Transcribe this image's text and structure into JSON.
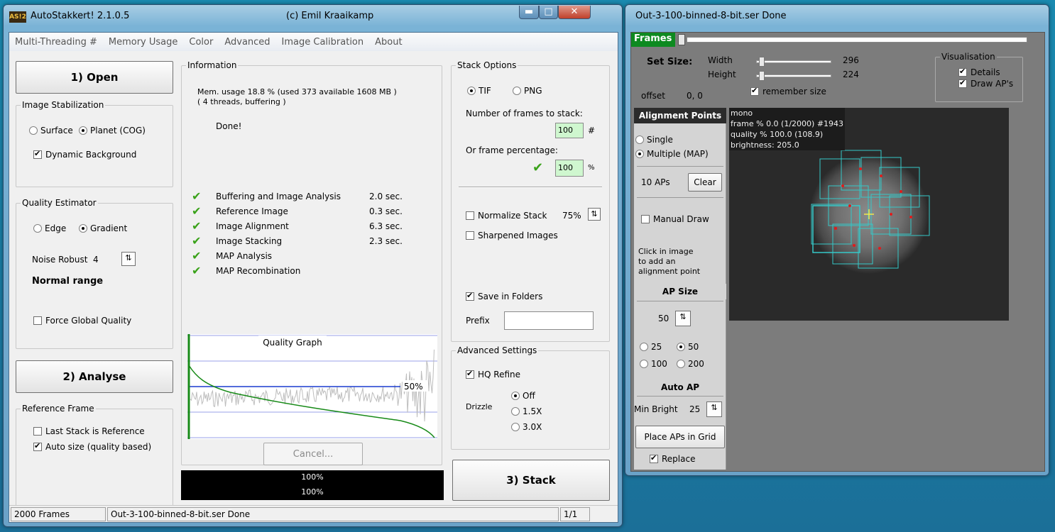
{
  "main": {
    "title": "AutoStakkert! 2.1.0.5",
    "author": "(c) Emil Kraaikamp",
    "app_icon": "AS!2",
    "menu": [
      "Multi-Threading #",
      "Memory Usage",
      "Color",
      "Advanced",
      "Image Calibration",
      "About"
    ],
    "open_btn": "1) Open",
    "stab_group": "Image Stabilization",
    "surface": "Surface",
    "planet": "Planet (COG)",
    "dyn_bg": "Dynamic Background",
    "quality_group": "Quality Estimator",
    "edge": "Edge",
    "gradient": "Gradient",
    "noise_label": "Noise Robust",
    "noise_value": "4",
    "normal_range": "Normal range",
    "force_global": "Force Global Quality",
    "analyse_btn": "2) Analyse",
    "ref_group": "Reference Frame",
    "last_stack": "Last Stack is Reference",
    "auto_size": "Auto size (quality based)",
    "info_group": "Information",
    "mem_usage": "Mem. usage 18.8 %  (used 373 available 1608 MB )",
    "threads": "( 4 threads, buffering )",
    "done": "Done!",
    "steps": [
      {
        "label": "Buffering and Image Analysis",
        "time": "2.0 sec."
      },
      {
        "label": "Reference Image",
        "time": "0.3 sec."
      },
      {
        "label": "Image Alignment",
        "time": "6.3 sec."
      },
      {
        "label": "Image Stacking",
        "time": "2.3 sec."
      },
      {
        "label": "MAP Analysis",
        "time": ""
      },
      {
        "label": "MAP Recombination",
        "time": ""
      }
    ],
    "graph_title": "Quality Graph",
    "graph_pct": "50%",
    "cancel_btn": "Cancel...",
    "progress1": "100%",
    "progress2": "100%",
    "stack_group": "Stack Options",
    "tif": "TIF",
    "png": "PNG",
    "frames_label": "Number of frames to stack:",
    "frames_value": "100",
    "frames_unit": "#",
    "pct_label": "Or frame percentage:",
    "pct_value": "100",
    "pct_unit": "%",
    "normalize": "Normalize Stack",
    "normalize_val": "75%",
    "sharpened": "Sharpened Images",
    "save_folders": "Save in Folders",
    "prefix": "Prefix",
    "adv_group": "Advanced Settings",
    "hq_refine": "HQ Refine",
    "drizzle": "Drizzle",
    "drizzle_off": "Off",
    "drizzle_15": "1.5X",
    "drizzle_30": "3.0X",
    "stack_btn": "3) Stack",
    "status_frames": "2000 Frames",
    "status_file": "Out-3-100-binned-8-bit.ser  Done",
    "status_page": "1/1"
  },
  "viewer": {
    "title": "Out-3-100-binned-8-bit.ser  Done",
    "frames_label": "Frames",
    "set_size": "Set Size:",
    "width_label": "Width",
    "width_value": "296",
    "height_label": "Height",
    "height_value": "224",
    "remember": "remember size",
    "offset_label": "offset",
    "offset_value": "0, 0",
    "vis_group": "Visualisation",
    "details": "Details",
    "draw_aps": "Draw AP's",
    "ap_header": "Alignment Points",
    "single": "Single",
    "multiple": "Multiple (MAP)",
    "ap_count": "10 APs",
    "clear_btn": "Clear",
    "manual_draw": "Manual Draw",
    "help1": "Click in image",
    "help2": "to add an",
    "help3": "alignment point",
    "ap_size": "AP Size",
    "ap_size_val": "50",
    "s25": "25",
    "s50": "50",
    "s100": "100",
    "s200": "200",
    "auto_ap": "Auto AP",
    "min_bright": "Min Bright",
    "min_bright_val": "25",
    "place_btn": "Place APs in Grid",
    "replace": "Replace",
    "ov1": "mono",
    "ov2": "frame % 0.0 (1/2000) #1943",
    "ov3": "quality % 100.0  (108.9)",
    "ov4": "brightness: 205.0"
  },
  "colors": {
    "accent_green": "#3aa21a",
    "viewer_bg": "#7c7c7c",
    "ap_box": "#35c8c8"
  }
}
